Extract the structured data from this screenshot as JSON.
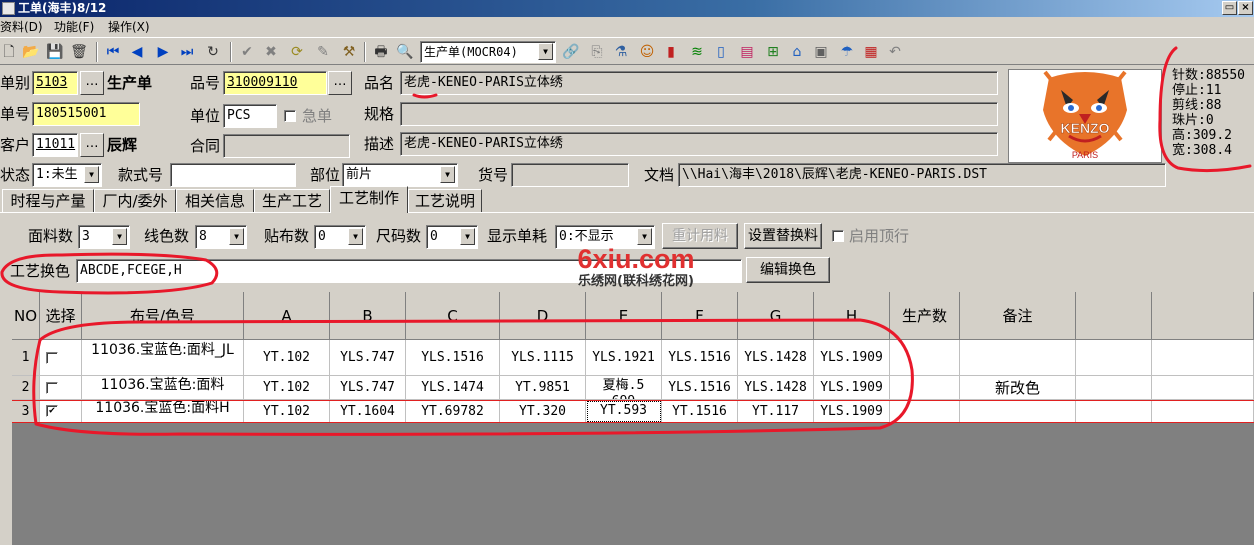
{
  "window": {
    "title": "工单(海丰)8/12",
    "restore_label": "▭"
  },
  "menu": [
    {
      "label": "资料(D)"
    },
    {
      "label": "功能(F)"
    },
    {
      "label": "操作(X)"
    }
  ],
  "toolbar": {
    "report_select": "生产单(MOCR04)",
    "icons": [
      "new-icon",
      "open-icon",
      "save-icon",
      "delete-icon",
      "first-icon",
      "prev-icon",
      "next-icon",
      "last-icon",
      "refresh-icon",
      "confirm-icon",
      "cancel-icon",
      "redo-icon",
      "edit-icon",
      "tool-icon",
      "print-icon",
      "preview-icon",
      "link-icon",
      "copy-icon",
      "flask-icon",
      "user-icon",
      "chart-icon",
      "wifi-icon",
      "usb-icon",
      "report-icon",
      "tree-icon",
      "home-icon",
      "window-icon",
      "umbrella-icon",
      "grid-icon",
      "undo-icon"
    ]
  },
  "form": {
    "order_type_label": "单别",
    "order_type": "5103",
    "order_type_name": "生产单",
    "item_no_label": "品号",
    "item_no": "310009110",
    "item_name_label": "品名",
    "item_name": "老虎-KENEO-PARIS立体绣",
    "order_no_label": "单号",
    "order_no": "180515001",
    "unit_label": "单位",
    "unit": "PCS",
    "urgent_label": "急单",
    "spec_label": "规格",
    "spec": "",
    "customer_label": "客户",
    "customer": "11011",
    "customer_name": "辰辉",
    "contract_label": "合同",
    "contract": "",
    "desc_label": "描述",
    "desc": "老虎-KENEO-PARIS立体绣",
    "status_label": "状态",
    "status": "1:未生",
    "style_label": "款式号",
    "style": "",
    "part_label": "部位",
    "part": "前片",
    "goods_label": "货号",
    "goods": "",
    "file_label": "文档",
    "file": "\\\\Hai\\海丰\\2018\\辰辉\\老虎-KENEO-PARIS.DST"
  },
  "logo": {
    "text": "KENZO",
    "sub": "PARIS"
  },
  "stats": [
    {
      "label": "针数",
      "value": ":88550"
    },
    {
      "label": "停止",
      "value": ":11"
    },
    {
      "label": "剪线",
      "value": ":88"
    },
    {
      "label": "珠片",
      "value": ":0"
    },
    {
      "label": "高",
      "value": ":309.2"
    },
    {
      "label": "宽",
      "value": ":308.4"
    }
  ],
  "tabs": [
    {
      "label": "时程与产量"
    },
    {
      "label": "厂内/委外"
    },
    {
      "label": "相关信息"
    },
    {
      "label": "生产工艺"
    },
    {
      "label": "工艺制作"
    },
    {
      "label": "工艺说明"
    }
  ],
  "active_tab": 4,
  "craft": {
    "fabric_count_label": "面料数",
    "fabric_count": "3",
    "thread_count_label": "线色数",
    "thread_count": "8",
    "patch_count_label": "贴布数",
    "patch_count": "0",
    "size_count_label": "尺码数",
    "size_count": "0",
    "show_usage_label": "显示单耗",
    "show_usage": "0:不显示",
    "recalc_button": "重计用料",
    "set_replace_button": "设置替换料",
    "enable_top_label": "启用顶行",
    "color_change_label": "工艺换色",
    "color_change": "ABCDE,FCEGE,H",
    "edit_color_button": "编辑换色"
  },
  "watermark": {
    "title": "6xiu.com",
    "subtitle": "乐绣网(联科绣花网)"
  },
  "grid": {
    "columns": [
      "NO",
      "选择",
      "布号/色号",
      "A",
      "B",
      "C",
      "D",
      "E",
      "F",
      "G",
      "H",
      "生产数",
      "备注",
      "",
      ""
    ],
    "rows": [
      {
        "no": "1",
        "checked": false,
        "name": "11036.宝蓝色:面料_JL",
        "cells": [
          "YT.102",
          "YLS.747",
          "YLS.1516",
          "YLS.1115",
          "YLS.1921",
          "YLS.1516",
          "YLS.1428",
          "YLS.1909"
        ],
        "qty": "",
        "note": ""
      },
      {
        "no": "2",
        "checked": false,
        "name": "11036.宝蓝色:面料",
        "cells": [
          "YT.102",
          "YLS.747",
          "YLS.1474",
          "YT.9851",
          "夏梅.5699",
          "YLS.1516",
          "YLS.1428",
          "YLS.1909"
        ],
        "qty": "",
        "note": "新改色"
      },
      {
        "no": "3",
        "checked": true,
        "name": "11036.宝蓝色:面料H",
        "cells": [
          "YT.102",
          "YT.1604",
          "YT.69782",
          "YT.320",
          "YT.593",
          "YT.1516",
          "YT.117",
          "YLS.1909"
        ],
        "qty": "",
        "note": ""
      }
    ]
  }
}
